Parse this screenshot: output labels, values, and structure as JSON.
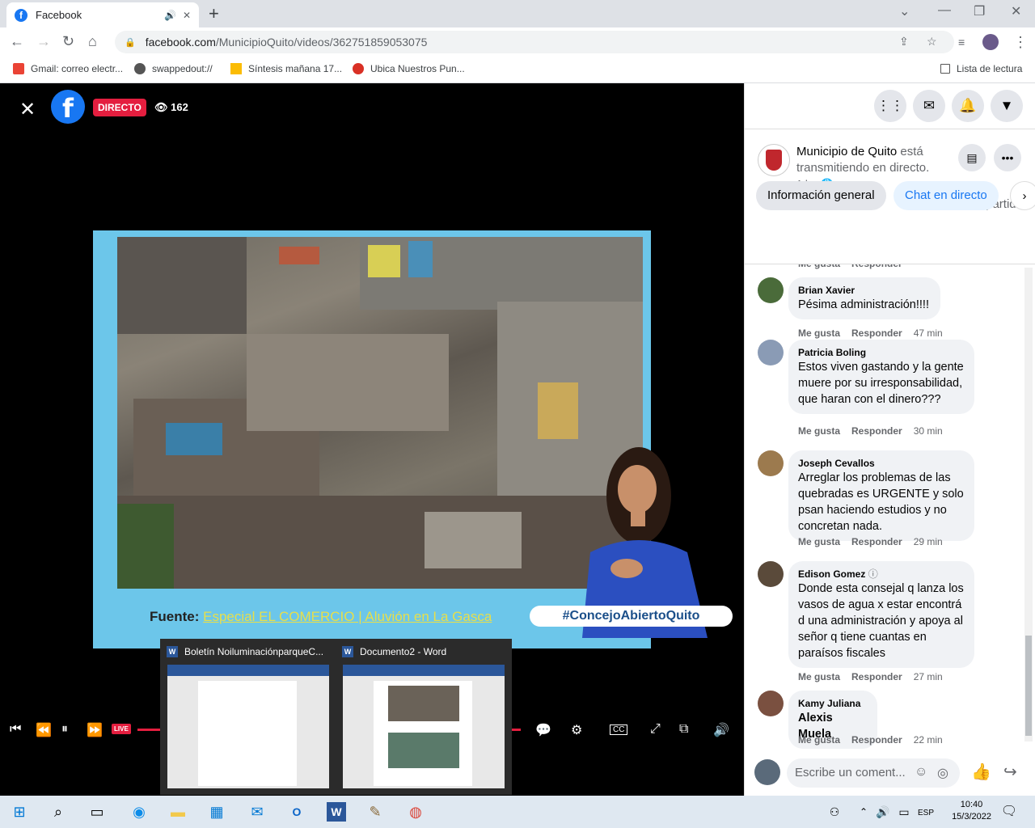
{
  "browser": {
    "tab_title": "Facebook",
    "url_host": "facebook.com",
    "url_path": "/MunicipioQuito/videos/362751859053075",
    "bookmarks": [
      "Gmail: correo electr...",
      "swappedout://",
      "Síntesis mañana 17...",
      "Ubica Nuestros Pun..."
    ],
    "reading_list": "Lista de lectura"
  },
  "viewer": {
    "live_badge": "DIRECTO",
    "viewer_count": "162",
    "fuente_label": "Fuente:",
    "fuente_source": "Especial EL COMERCIO  |  Aluvión en La Gasca",
    "hashtag": "#ConcejoAbiertoQuito",
    "live_small": "LIVE"
  },
  "taskbar_thumbs": [
    {
      "title": "Boletín NoiluminaciónparqueC..."
    },
    {
      "title": "Documento2 - Word"
    }
  ],
  "page": {
    "name": "Municipio de Quito",
    "status": "está transmitiendo en directo.",
    "time": "1 h ·",
    "shares": "2 veces compartida",
    "tab_general": "Información general",
    "tab_chat": "Chat en directo"
  },
  "comments": [
    {
      "name": "Brian Xavier",
      "text": "Pésima administración!!!!",
      "time": "47 min",
      "avatar_color": "#4a6b3a"
    },
    {
      "name": "Patricia Boling",
      "text": "Estos viven gastando y la gente muere por su irresponsabilidad, que haran con el dinero???",
      "time": "30 min",
      "avatar_color": "#8a9bb5"
    },
    {
      "name": "Joseph Cevallos",
      "text": "Arreglar los problemas de las quebradas es URGENTE y solo psan haciendo estudios y no concretan nada.",
      "time": "29 min",
      "avatar_color": "#9c7a4e"
    },
    {
      "name": "Edison Gomez",
      "text": "Donde esta consejal q lanza los vasos de agua x estar encontrá d una administración y apoya al señor q tiene cuantas en paraísos fiscales",
      "time": "27 min",
      "avatar_color": "#5a4a3a"
    },
    {
      "name": "Kamy Juliana",
      "text": "Alexis Muela",
      "time": "22 min",
      "avatar_color": "#7a5040"
    }
  ],
  "comment_actions": {
    "like": "Me gusta",
    "reply": "Responder"
  },
  "composer_placeholder": "Escribe un coment...",
  "system": {
    "lang": "ESP",
    "time": "10:40",
    "date": "15/3/2022"
  }
}
